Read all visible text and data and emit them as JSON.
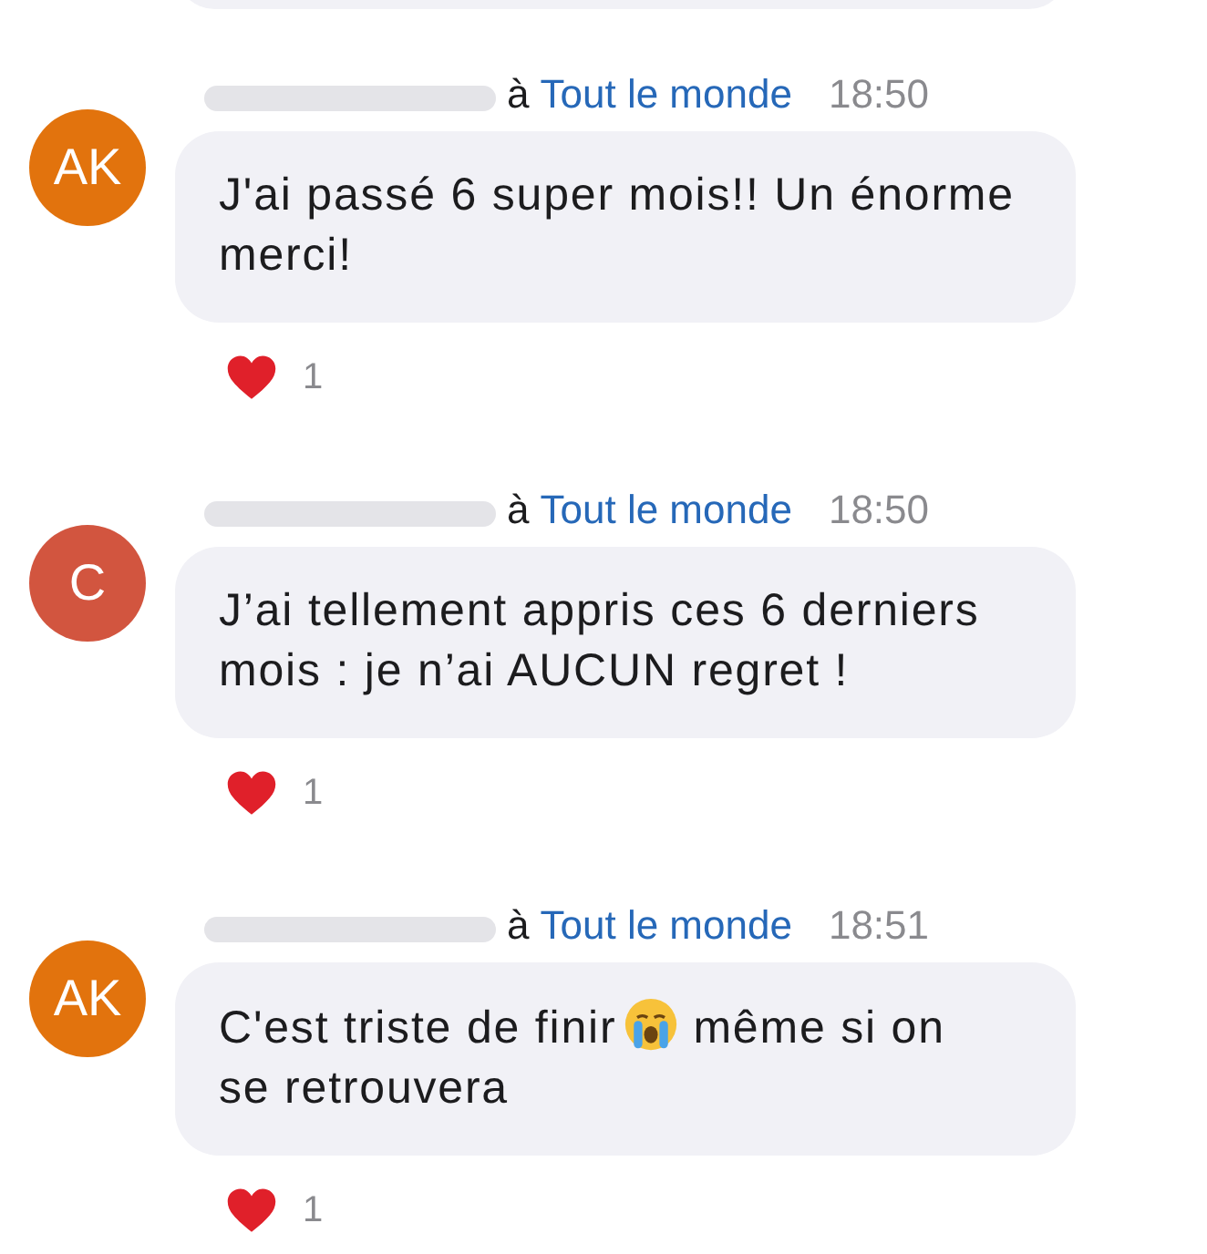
{
  "messages": [
    {
      "avatar": {
        "initials": "AK",
        "color": "#e2730d"
      },
      "connector": "à",
      "audience": "Tout le monde",
      "time": "18:50",
      "parts": [
        {
          "kind": "text",
          "text": "J'ai passé 6 super mois!! Un énorme merci!"
        }
      ],
      "reactions": [
        {
          "kind": "heart",
          "count": "1"
        }
      ]
    },
    {
      "avatar": {
        "initials": "C",
        "color": "#d2553f"
      },
      "connector": "à",
      "audience": "Tout le monde",
      "time": "18:50",
      "parts": [
        {
          "kind": "text",
          "text": "J’ai tellement appris ces 6 derniers mois : je n’ai AUCUN regret !"
        }
      ],
      "reactions": [
        {
          "kind": "heart",
          "count": "1"
        }
      ]
    },
    {
      "avatar": {
        "initials": "AK",
        "color": "#e2730d"
      },
      "connector": "à",
      "audience": "Tout le monde",
      "time": "18:51",
      "parts": [
        {
          "kind": "text",
          "text": "C'est triste de finir"
        },
        {
          "kind": "emoji"
        },
        {
          "kind": "text",
          "text": "même si on"
        },
        {
          "kind": "text",
          "text": "se retrouvera"
        }
      ],
      "reactions": [
        {
          "kind": "heart",
          "count": "1"
        }
      ]
    }
  ]
}
